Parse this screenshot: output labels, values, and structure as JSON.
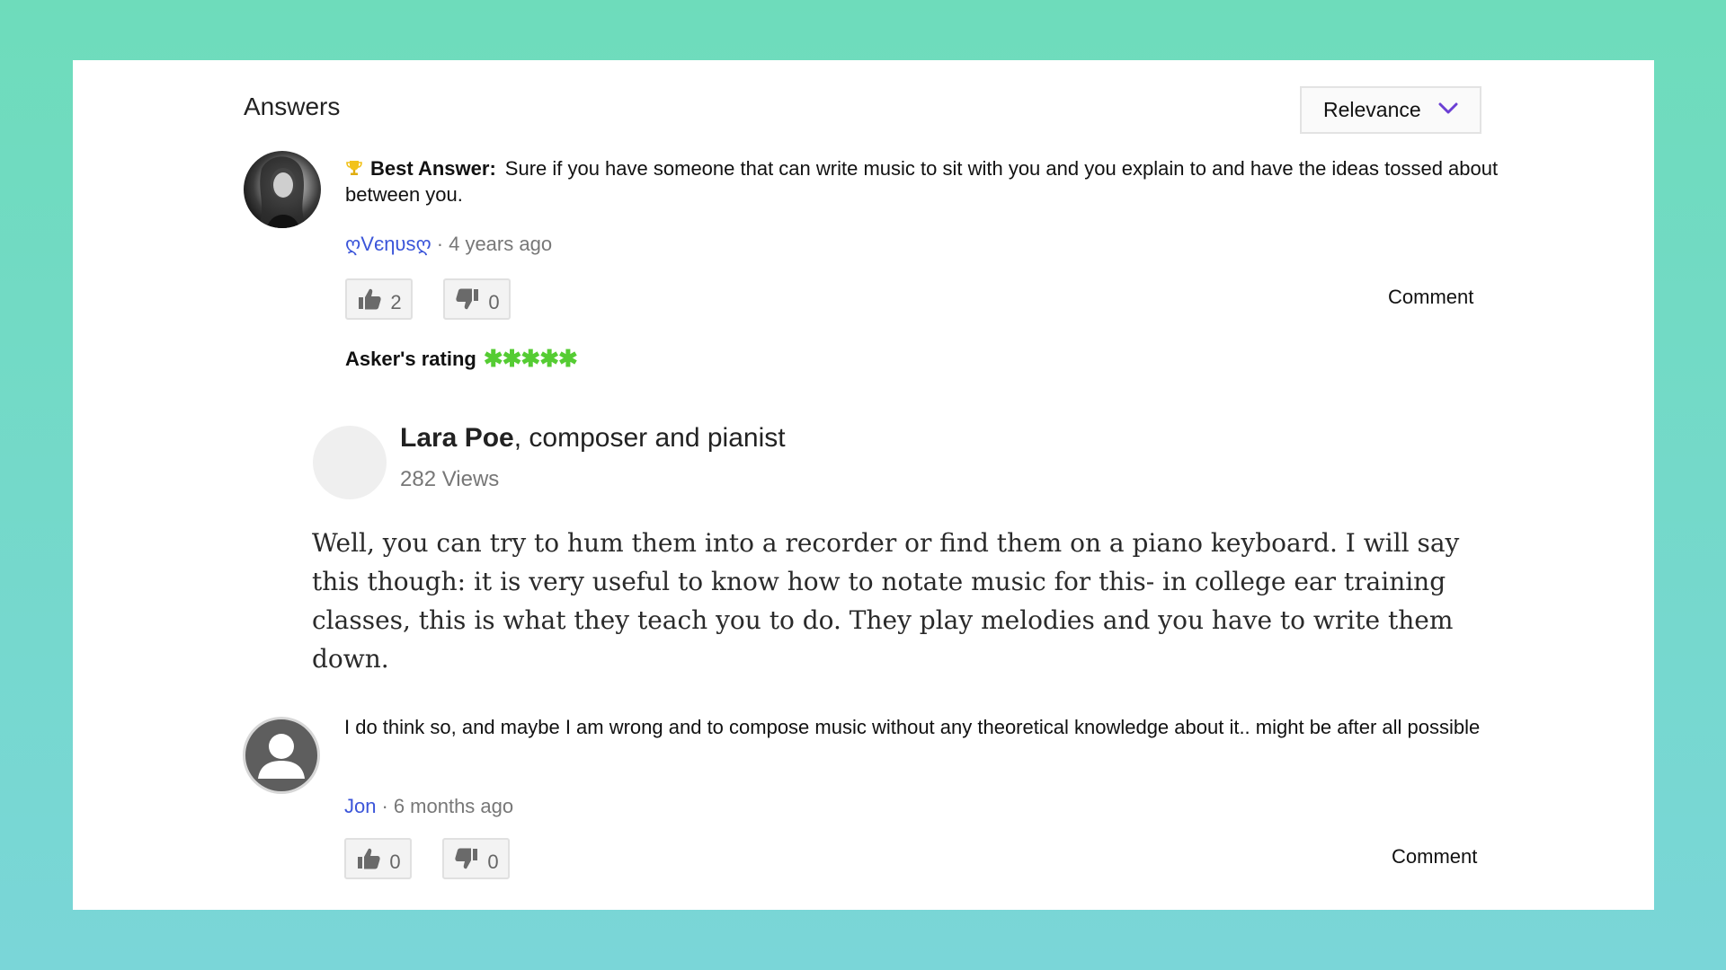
{
  "header": {
    "title": "Answers"
  },
  "sort": {
    "selected": "Relevance"
  },
  "best_answer": {
    "label": "Best Answer:",
    "text": "Sure if you have someone that can write music to sit with you and you explain to and have the ideas tossed about between you.",
    "user": "ღVєηυѕღ",
    "separator": "·",
    "time": "4 years ago",
    "upvotes": "2",
    "downvotes": "0",
    "comment_label": "Comment",
    "asker_rating_label": "Asker's rating",
    "asker_rating_stars": "✱✱✱✱✱",
    "asker_rating_value": 5
  },
  "quote": {
    "author_name": "Lara Poe",
    "author_title": ", composer and pianist",
    "views": "282 Views",
    "body": "Well, you can try to hum them into a recorder or find them on a piano keyboard.  I will say this though: it is very useful to know how to notate music for this- in college ear training classes, this is what they teach you to do.  They play melodies and you have to write them down."
  },
  "answer_2": {
    "text": "I do think so, and maybe I am wrong and to compose music without any theoretical knowledge about it.. might be af­ter all possible",
    "user": "Jon",
    "separator": "·",
    "time": "6 months ago",
    "upvotes": "0",
    "downvotes": "0",
    "comment_label": "Comment"
  },
  "colors": {
    "background_top": "#6edcbb",
    "background_bottom": "#7ad6d8",
    "link": "#3b55d9",
    "stars": "#55cc33",
    "chevron": "#6b3fd4",
    "trophy": "#f2c21b"
  },
  "icons": {
    "sort": "chevron-down-icon",
    "best": "trophy-icon",
    "up": "thumbs-up-icon",
    "down": "thumbs-down-icon",
    "generic_avatar": "user-silhouette-icon"
  }
}
